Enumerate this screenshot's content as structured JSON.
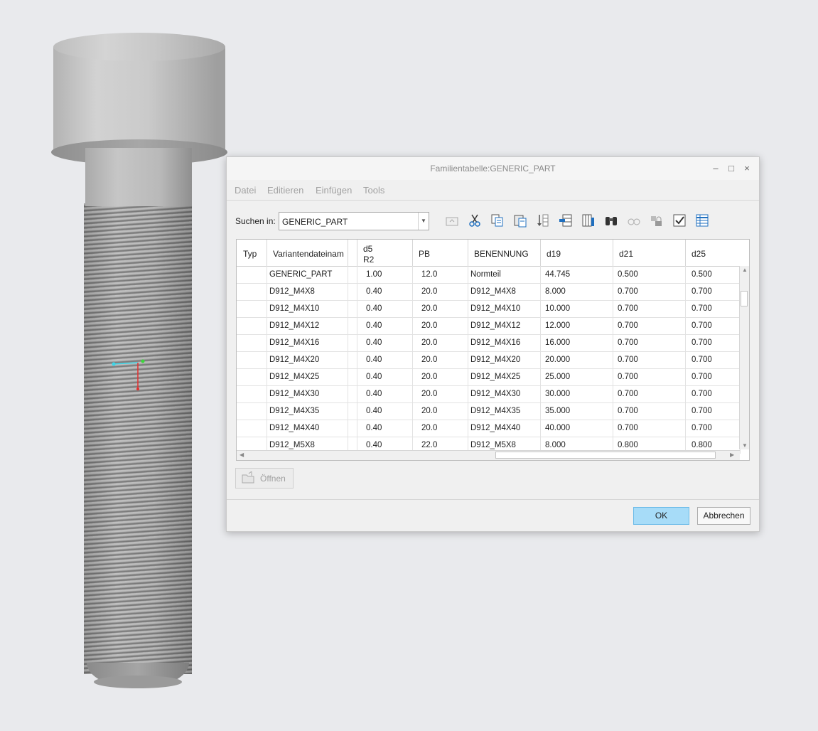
{
  "dialog": {
    "title": "Familientabelle:GENERIC_PART",
    "window_buttons": {
      "minimize": "–",
      "maximize": "□",
      "close": "×"
    }
  },
  "menu": [
    "Datei",
    "Editieren",
    "Einfügen",
    "Tools"
  ],
  "search": {
    "label": "Suchen in:",
    "value": "GENERIC_PART"
  },
  "toolbar_icons": [
    "open-folder-icon",
    "cut-icon",
    "copy-icon",
    "paste-icon",
    "sort-icon",
    "insert-row-icon",
    "insert-column-icon",
    "find-icon",
    "glasses-icon",
    "lock-icon",
    "verify-icon",
    "table-icon"
  ],
  "table": {
    "columns": [
      {
        "l1": "Typ",
        "l2": ""
      },
      {
        "l1": "Variantendateinam",
        "l2": ""
      },
      {
        "l1": "d5",
        "l2": "R2"
      },
      {
        "l1": "PB",
        "l2": ""
      },
      {
        "l1": "BENENNUNG",
        "l2": ""
      },
      {
        "l1": "d19",
        "l2": ""
      },
      {
        "l1": "d21",
        "l2": ""
      },
      {
        "l1": "d25",
        "l2": ""
      }
    ],
    "rows": [
      [
        "",
        "GENERIC_PART",
        "1.00",
        "12.0",
        "Normteil",
        "44.745",
        "0.500",
        "0.500"
      ],
      [
        "",
        "D912_M4X8",
        "0.40",
        "20.0",
        "D912_M4X8",
        "8.000",
        "0.700",
        "0.700"
      ],
      [
        "",
        "D912_M4X10",
        "0.40",
        "20.0",
        "D912_M4X10",
        "10.000",
        "0.700",
        "0.700"
      ],
      [
        "",
        "D912_M4X12",
        "0.40",
        "20.0",
        "D912_M4X12",
        "12.000",
        "0.700",
        "0.700"
      ],
      [
        "",
        "D912_M4X16",
        "0.40",
        "20.0",
        "D912_M4X16",
        "16.000",
        "0.700",
        "0.700"
      ],
      [
        "",
        "D912_M4X20",
        "0.40",
        "20.0",
        "D912_M4X20",
        "20.000",
        "0.700",
        "0.700"
      ],
      [
        "",
        "D912_M4X25",
        "0.40",
        "20.0",
        "D912_M4X25",
        "25.000",
        "0.700",
        "0.700"
      ],
      [
        "",
        "D912_M4X30",
        "0.40",
        "20.0",
        "D912_M4X30",
        "30.000",
        "0.700",
        "0.700"
      ],
      [
        "",
        "D912_M4X35",
        "0.40",
        "20.0",
        "D912_M4X35",
        "35.000",
        "0.700",
        "0.700"
      ],
      [
        "",
        "D912_M4X40",
        "0.40",
        "20.0",
        "D912_M4X40",
        "40.000",
        "0.700",
        "0.700"
      ],
      [
        "",
        "D912_M5X8",
        "0.40",
        "22.0",
        "D912_M5X8",
        "8.000",
        "0.800",
        "0.800"
      ]
    ]
  },
  "open_button": "Öffnen",
  "ok_button": "OK",
  "cancel_button": "Abbrechen",
  "colors": {
    "ok_bg": "#a7dcf8",
    "accent_blue": "#1f6fbf"
  }
}
